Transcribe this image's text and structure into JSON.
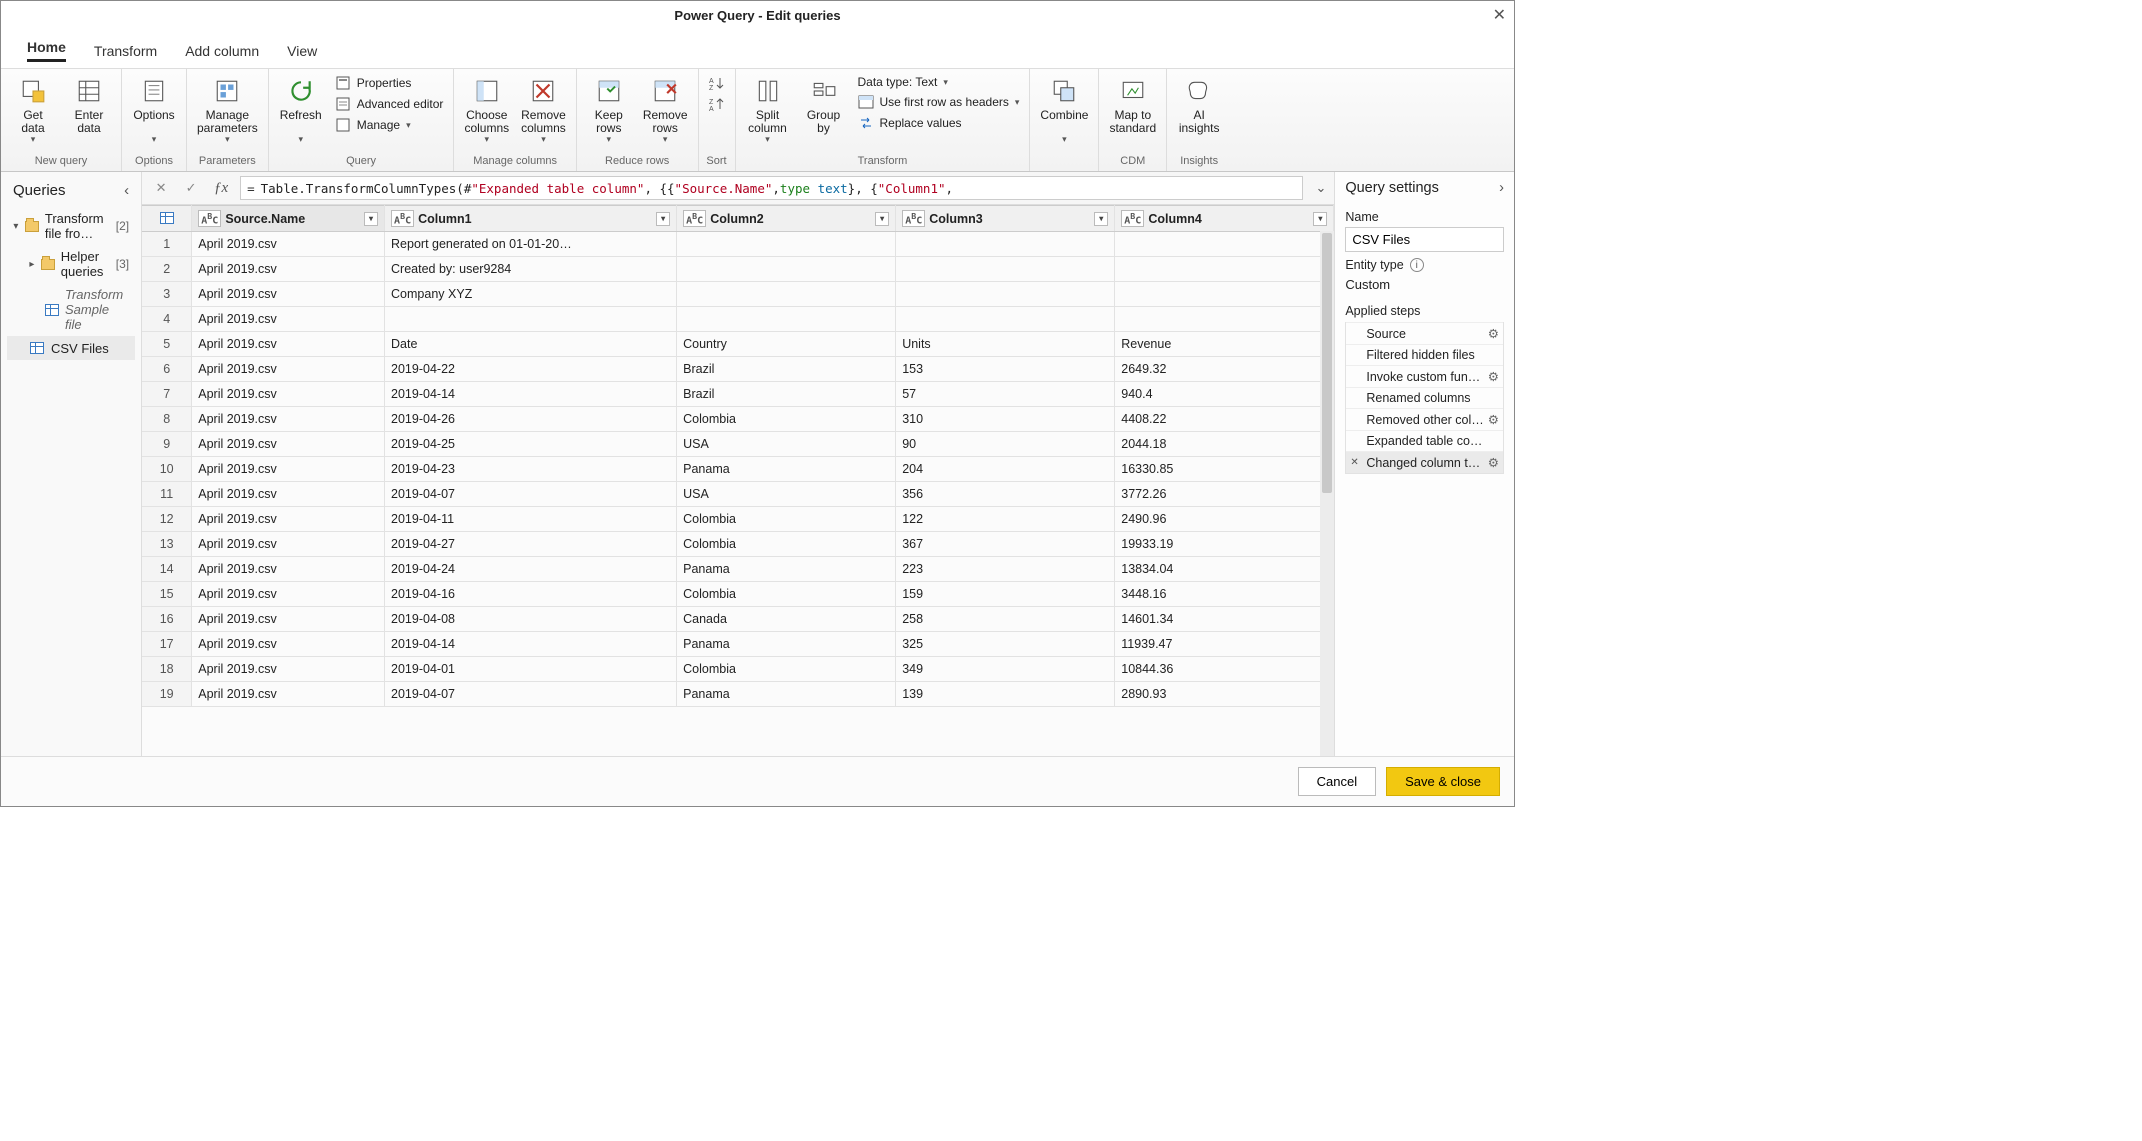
{
  "window": {
    "title": "Power Query - Edit queries"
  },
  "tabs": {
    "home": "Home",
    "transform": "Transform",
    "addcol": "Add column",
    "view": "View"
  },
  "ribbon": {
    "newquery": {
      "label": "New query",
      "getdata": "Get\ndata",
      "enterdata": "Enter\ndata"
    },
    "options": {
      "label": "Options",
      "options": "Options"
    },
    "parameters": {
      "label": "Parameters",
      "manage": "Manage\nparameters"
    },
    "query": {
      "label": "Query",
      "refresh": "Refresh",
      "properties": "Properties",
      "adveditor": "Advanced editor",
      "manage": "Manage"
    },
    "mcols": {
      "label": "Manage columns",
      "choose": "Choose\ncolumns",
      "remove": "Remove\ncolumns"
    },
    "rrows": {
      "label": "Reduce rows",
      "keep": "Keep\nrows",
      "remove": "Remove\nrows"
    },
    "sort": {
      "label": "Sort"
    },
    "transform": {
      "label": "Transform",
      "split": "Split\ncolumn",
      "group": "Group\nby",
      "datatype": "Data type: Text",
      "firstrow": "Use first row as headers",
      "replace": "Replace values"
    },
    "combine": {
      "label": "",
      "combine": "Combine"
    },
    "cdm": {
      "label": "CDM",
      "map": "Map to\nstandard"
    },
    "insights": {
      "label": "Insights",
      "ai": "AI\ninsights"
    }
  },
  "queries": {
    "header": "Queries",
    "items": {
      "transformFolder": {
        "label": "Transform file fro…",
        "count": "[2]"
      },
      "helper": {
        "label": "Helper queries",
        "count": "[3]"
      },
      "sample": {
        "label": "Transform Sample file"
      },
      "csv": {
        "label": "CSV Files"
      }
    }
  },
  "formula": {
    "prefix": "Table.TransformColumnTypes(#",
    "q1": "\"Expanded table column\"",
    "mid": ", {{",
    "q2": "\"Source.Name\"",
    "mid2": ", ",
    "typekw": "type",
    "textkw": "text",
    "tail": "}, {",
    "q3": "\"Column1\"",
    "tail2": ","
  },
  "columns": [
    "Source.Name",
    "Column1",
    "Column2",
    "Column3",
    "Column4"
  ],
  "rows": [
    [
      "April 2019.csv",
      "Report generated on 01-01-20…",
      "",
      "",
      ""
    ],
    [
      "April 2019.csv",
      "Created by: user9284",
      "",
      "",
      ""
    ],
    [
      "April 2019.csv",
      "Company XYZ",
      "",
      "",
      ""
    ],
    [
      "April 2019.csv",
      "",
      "",
      "",
      ""
    ],
    [
      "April 2019.csv",
      "Date",
      "Country",
      "Units",
      "Revenue"
    ],
    [
      "April 2019.csv",
      "2019-04-22",
      "Brazil",
      "153",
      "2649.32"
    ],
    [
      "April 2019.csv",
      "2019-04-14",
      "Brazil",
      "57",
      "940.4"
    ],
    [
      "April 2019.csv",
      "2019-04-26",
      "Colombia",
      "310",
      "4408.22"
    ],
    [
      "April 2019.csv",
      "2019-04-25",
      "USA",
      "90",
      "2044.18"
    ],
    [
      "April 2019.csv",
      "2019-04-23",
      "Panama",
      "204",
      "16330.85"
    ],
    [
      "April 2019.csv",
      "2019-04-07",
      "USA",
      "356",
      "3772.26"
    ],
    [
      "April 2019.csv",
      "2019-04-11",
      "Colombia",
      "122",
      "2490.96"
    ],
    [
      "April 2019.csv",
      "2019-04-27",
      "Colombia",
      "367",
      "19933.19"
    ],
    [
      "April 2019.csv",
      "2019-04-24",
      "Panama",
      "223",
      "13834.04"
    ],
    [
      "April 2019.csv",
      "2019-04-16",
      "Colombia",
      "159",
      "3448.16"
    ],
    [
      "April 2019.csv",
      "2019-04-08",
      "Canada",
      "258",
      "14601.34"
    ],
    [
      "April 2019.csv",
      "2019-04-14",
      "Panama",
      "325",
      "11939.47"
    ],
    [
      "April 2019.csv",
      "2019-04-01",
      "Colombia",
      "349",
      "10844.36"
    ],
    [
      "April 2019.csv",
      "2019-04-07",
      "Panama",
      "139",
      "2890.93"
    ]
  ],
  "settings": {
    "header": "Query settings",
    "nameLabel": "Name",
    "nameValue": "CSV Files",
    "entityLabel": "Entity type",
    "entityValue": "Custom",
    "stepsLabel": "Applied steps",
    "steps": [
      {
        "label": "Source",
        "gear": true
      },
      {
        "label": "Filtered hidden files",
        "gear": false
      },
      {
        "label": "Invoke custom fun…",
        "gear": true
      },
      {
        "label": "Renamed columns",
        "gear": false
      },
      {
        "label": "Removed other col…",
        "gear": true
      },
      {
        "label": "Expanded table co…",
        "gear": false
      },
      {
        "label": "Changed column t…",
        "gear": true,
        "selected": true
      }
    ]
  },
  "footer": {
    "cancel": "Cancel",
    "save": "Save & close"
  }
}
